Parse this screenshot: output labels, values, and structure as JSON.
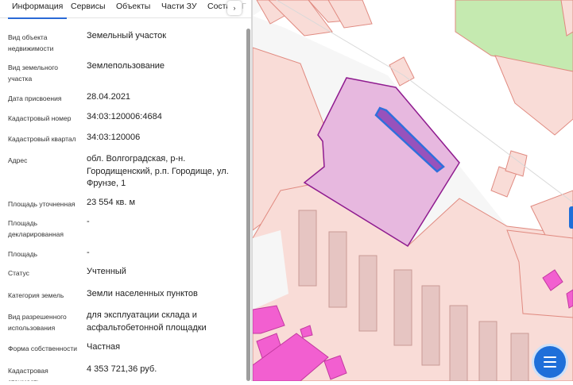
{
  "tabs": [
    {
      "label": "Информация",
      "active": true
    },
    {
      "label": "Сервисы",
      "active": false
    },
    {
      "label": "Объекты",
      "active": false
    },
    {
      "label": "Части ЗУ",
      "active": false
    },
    {
      "label": "Соста",
      "active": false
    }
  ],
  "tab_next_icon": "›",
  "tab_cut_text": "Г",
  "fields": [
    {
      "label": "Вид объекта\nнедвижимости",
      "value": "Земельный участок"
    },
    {
      "label": "Вид земельного\nучастка",
      "value": "Землепользование"
    },
    {
      "label": "Дата присвоения",
      "value": "28.04.2021"
    },
    {
      "label": "Кадастровый номер",
      "value": "34:03:120006:4684"
    },
    {
      "label": "Кадастровый квартал",
      "value": "34:03:120006"
    },
    {
      "label": "Адрес",
      "value": "обл. Волгоградская, р-н.\nГородищенский, р.п. Городище, ул.\nФрунзе, 1"
    },
    {
      "label": "Площадь уточненная",
      "value": "23 554 кв. м"
    },
    {
      "label": "Площадь\nдекларированная",
      "value": "-"
    },
    {
      "label": "Площадь",
      "value": "-"
    },
    {
      "label": "Статус",
      "value": "Учтенный"
    },
    {
      "label": "Категория земель",
      "value": "Земли населенных пунктов"
    },
    {
      "label": "Вид разрешенного\nиспользования",
      "value": "для эксплуатации склада и\nасфальтобетонной площадки"
    },
    {
      "label": "Форма собственности",
      "value": "Частная"
    },
    {
      "label": "Кадастровая\nстоимость",
      "value": "4 353 721,36 руб."
    }
  ],
  "map": {
    "colors": {
      "background": "#f6f6f6",
      "parcel_fill": "#f9dcd7",
      "parcel_stroke": "#e08a80",
      "road": "#ffffff",
      "green_area": "#c5eab0",
      "selected_fill": "#e7b8df",
      "selected_stroke": "#8f1b8f",
      "building_fill": "#8a3fb5",
      "building_stroke": "#2f6fdc",
      "structure_fill": "#e6c5c2",
      "structure_stroke": "#c99a96",
      "magenta": "#f25fd0"
    }
  },
  "menu_button_icon": "menu-icon"
}
